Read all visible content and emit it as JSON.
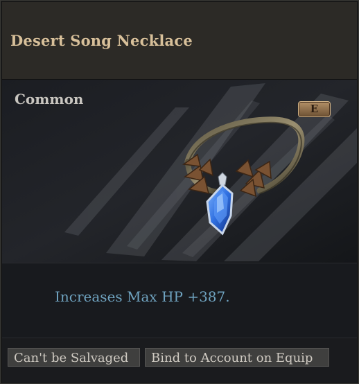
{
  "item": {
    "name": "Desert Song Necklace",
    "rarity": "Common",
    "keybind": "E",
    "stats": [
      "Increases Max HP +387."
    ],
    "tags": [
      "Can't be Salvaged",
      "Bind to Account on Equip"
    ]
  },
  "colors": {
    "name": "#d8c09a",
    "rarity": "#c9c6c0",
    "stat": "#6fa3c0",
    "gem": "#2f6fe0"
  },
  "icons": {
    "item_art": "necklace-icon"
  }
}
